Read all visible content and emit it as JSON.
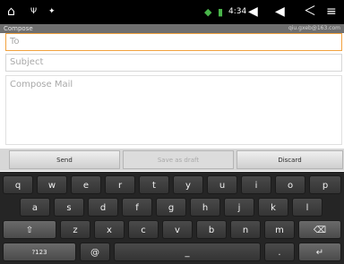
{
  "status_bar": {
    "home_icon": "home-icon",
    "usb_icon": "usb-icon",
    "debug_icon": "debug-icon",
    "wifi_icon": "wifi-icon",
    "battery_icon": "battery-icon",
    "time": "4:34",
    "volume_down_icon": "volume-down-icon",
    "volume_up_icon": "volume-up-icon",
    "back_icon": "back-icon",
    "menu_icon": "menu-icon"
  },
  "titlebar": {
    "title": "Compose",
    "account": "qiu.gxeb@163.com"
  },
  "compose": {
    "to_placeholder": "To",
    "subject_placeholder": "Subject",
    "body_placeholder": "Compose Mail"
  },
  "actions": {
    "send": "Send",
    "save_draft": "Save as draft",
    "discard": "Discard"
  },
  "keyboard": {
    "row1": [
      "q",
      "w",
      "e",
      "r",
      "t",
      "y",
      "u",
      "i",
      "o",
      "p"
    ],
    "row2": [
      "a",
      "s",
      "d",
      "f",
      "g",
      "h",
      "j",
      "k",
      "l"
    ],
    "row3": [
      "z",
      "x",
      "c",
      "v",
      "b",
      "n",
      "m"
    ],
    "shift_glyph": "⇧",
    "backspace_glyph": "⌫",
    "symbols": "?123",
    "at": "@",
    "space_glyph": "_",
    "dot": ".",
    "enter_glyph": "↵"
  },
  "colors": {
    "focus_outline": "#f2a23f",
    "status_bar_bg": "#000000",
    "keyboard_bg": "#252525"
  }
}
